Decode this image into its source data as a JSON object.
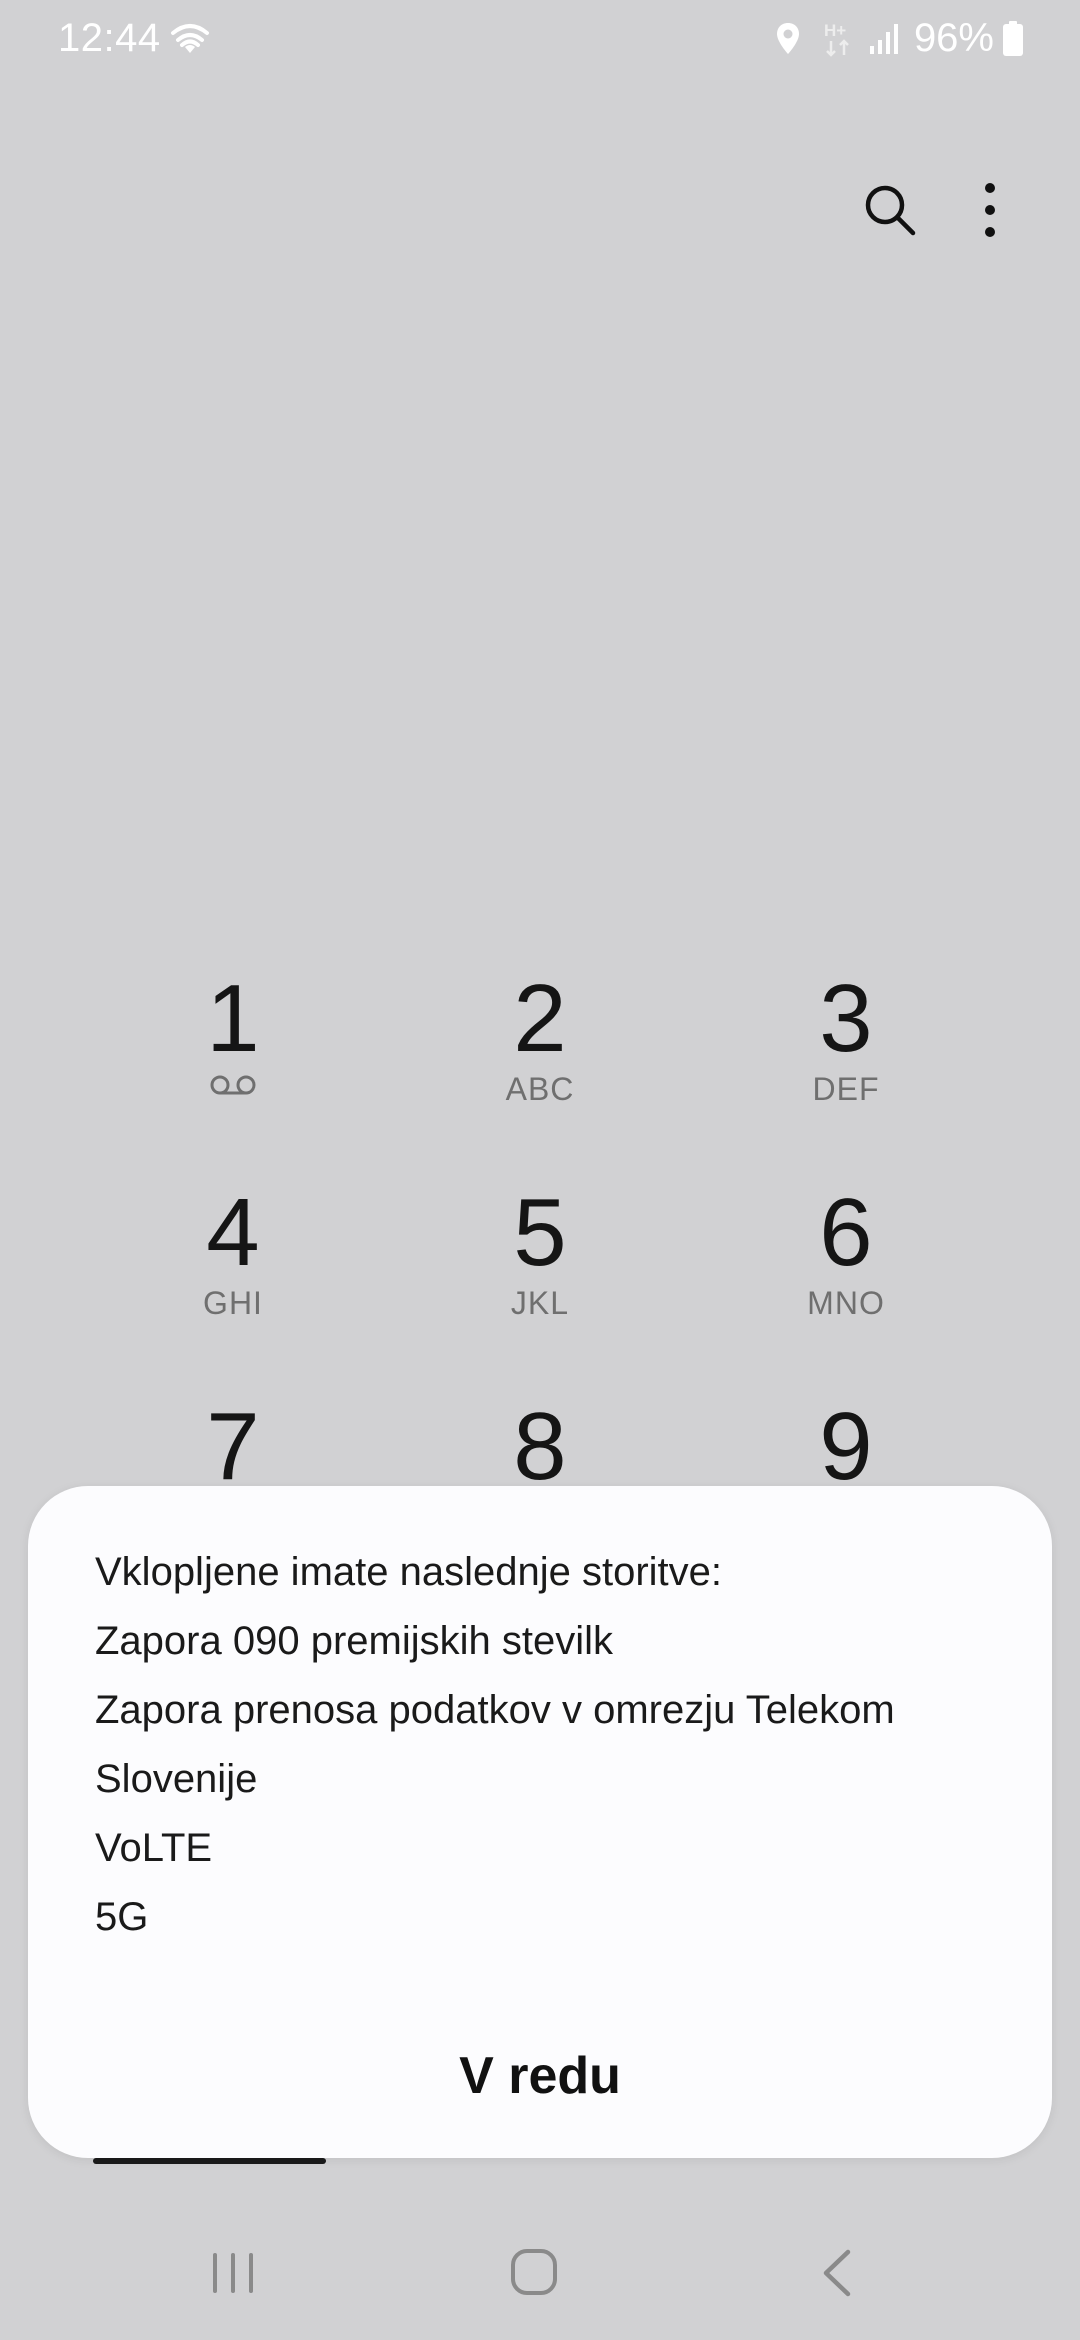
{
  "status_bar": {
    "time": "12:44",
    "battery": "96%",
    "icons": [
      "wifi-icon",
      "location-icon",
      "hplus-data-icon",
      "signal-icon",
      "battery-icon"
    ]
  },
  "toolbar": {
    "search_icon": "search-icon",
    "more_icon": "more-options-icon"
  },
  "dialpad": {
    "keys": [
      {
        "digit": "1",
        "letters": ""
      },
      {
        "digit": "2",
        "letters": "ABC"
      },
      {
        "digit": "3",
        "letters": "DEF"
      },
      {
        "digit": "4",
        "letters": "GHI"
      },
      {
        "digit": "5",
        "letters": "JKL"
      },
      {
        "digit": "6",
        "letters": "MNO"
      },
      {
        "digit": "7",
        "letters": ""
      },
      {
        "digit": "8",
        "letters": ""
      },
      {
        "digit": "9",
        "letters": ""
      }
    ]
  },
  "dialog": {
    "lines": [
      "Vklopljene imate naslednje storitve:",
      "Zapora 090 premijskih stevilk",
      "Zapora prenosa podatkov v omrezju Telekom",
      "Slovenije",
      "VoLTE",
      "5G"
    ],
    "ok_label": "V redu"
  },
  "colors": {
    "background": "#d1d1d3",
    "dialog": "#fcfcfe",
    "text": "#111111",
    "secondary_text": "#6f6f6f"
  }
}
